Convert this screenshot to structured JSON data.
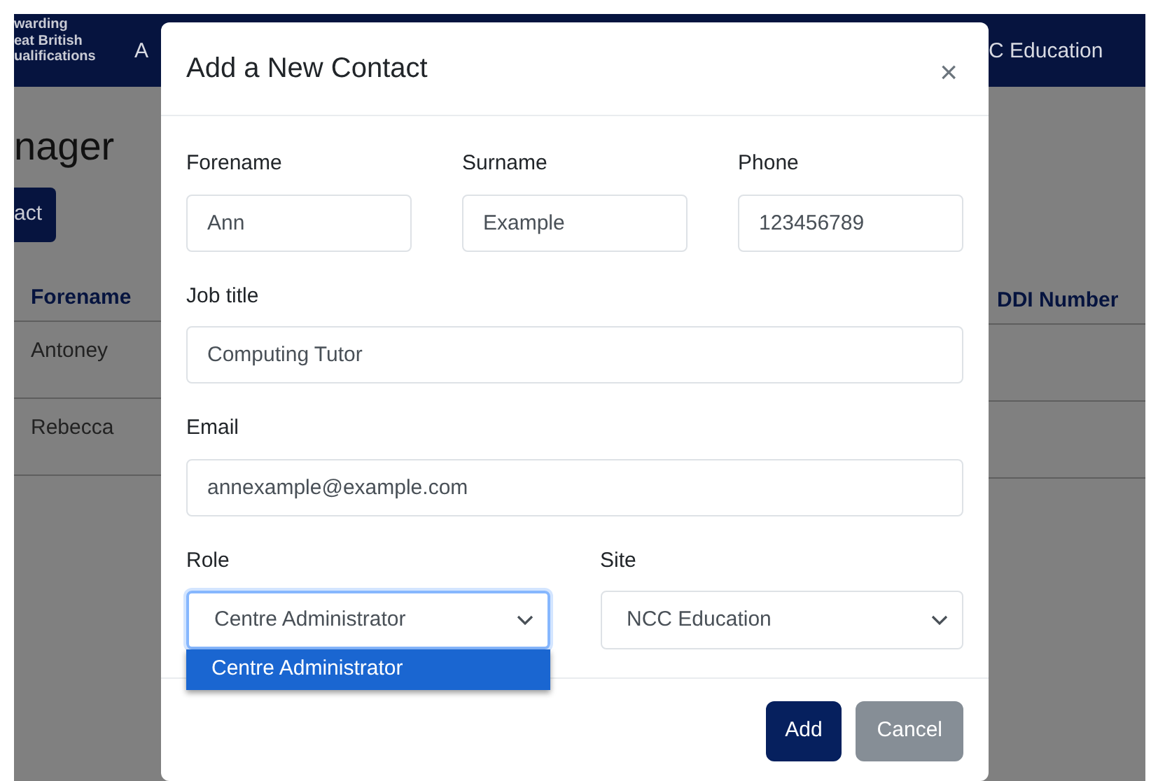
{
  "background_page": {
    "navbar": {
      "logo_lines": [
        "warding",
        "eat British",
        "ualifications"
      ],
      "left_link": "A",
      "right_link": "C Education"
    },
    "heading": "nager",
    "button": "act",
    "table": {
      "left_column": "Forename",
      "right_column": "DDI Number",
      "rows": [
        {
          "forename": "Antoney"
        },
        {
          "forename": "Rebecca"
        }
      ]
    }
  },
  "modal": {
    "title": "Add a New Contact",
    "close": "×",
    "rows": [
      [
        {
          "label": "Forename",
          "value": "Ann",
          "kind": "text",
          "focused": false
        },
        {
          "label": "Surname",
          "value": "Example",
          "kind": "text",
          "focused": false
        },
        {
          "label": "Phone",
          "value": "123456789",
          "kind": "text",
          "focused": false
        }
      ],
      [
        {
          "label": "Job title",
          "value": "Computing Tutor",
          "kind": "text",
          "focused": false
        }
      ],
      [
        {
          "label": "Email",
          "value": "annexample@example.com",
          "kind": "text",
          "focused": false
        }
      ],
      [
        {
          "label": "Role",
          "value": "Centre Administrator",
          "kind": "select",
          "focused": true,
          "options": [
            {
              "label": "Centre Administrator",
              "selected": true
            }
          ]
        },
        {
          "label": "Site",
          "value": "NCC Education",
          "kind": "select",
          "focused": false
        }
      ]
    ],
    "buttons": [
      {
        "label": "Add",
        "kind": "primary"
      },
      {
        "label": "Cancel",
        "kind": "secondary"
      }
    ]
  }
}
